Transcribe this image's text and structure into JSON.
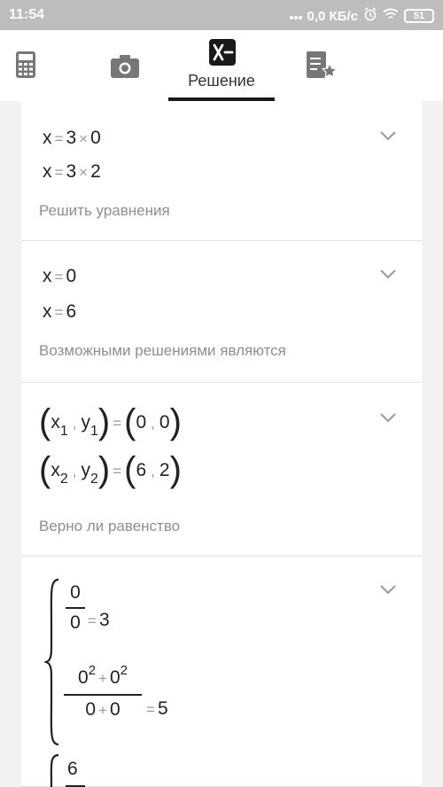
{
  "status_bar": {
    "time": "11:54",
    "network_speed": "0,0 КБ/с",
    "battery": "51"
  },
  "tabs": {
    "calculator_icon": "calculator-icon",
    "camera_icon": "camera-icon",
    "solution_label": "Решение",
    "saved_icon": "notebook-star-icon",
    "active": "solution"
  },
  "steps": [
    {
      "lines": [
        {
          "lhs": "x",
          "rel": "=",
          "a": "3",
          "op": "×",
          "b": "0"
        },
        {
          "lhs": "x",
          "rel": "=",
          "a": "3",
          "op": "×",
          "b": "2"
        }
      ],
      "caption": "Решить уравнения"
    },
    {
      "lines": [
        {
          "lhs": "x",
          "rel": "=",
          "rhs": "0"
        },
        {
          "lhs": "x",
          "rel": "=",
          "rhs": "6"
        }
      ],
      "caption": "Возможными решениями являются"
    },
    {
      "pairs": [
        {
          "x": "x",
          "x_sub": "1",
          "y": "y",
          "y_sub": "1",
          "rel": "=",
          "v1": "0",
          "v2": "0"
        },
        {
          "x": "x",
          "x_sub": "2",
          "y": "y",
          "y_sub": "2",
          "rel": "=",
          "v1": "6",
          "v2": "2"
        }
      ],
      "caption": "Верно ли равенство"
    },
    {
      "system1": {
        "eq1": {
          "num": "0",
          "den": "0",
          "rel": "=",
          "rhs": "3"
        },
        "eq2": {
          "num_a": "0",
          "num_a_exp": "2",
          "num_op": "+",
          "num_b": "0",
          "num_b_exp": "2",
          "den_a": "0",
          "den_op": "+",
          "den_b": "0",
          "rel": "=",
          "rhs": "5"
        }
      },
      "system2": {
        "eq1_num": "6"
      }
    }
  ]
}
